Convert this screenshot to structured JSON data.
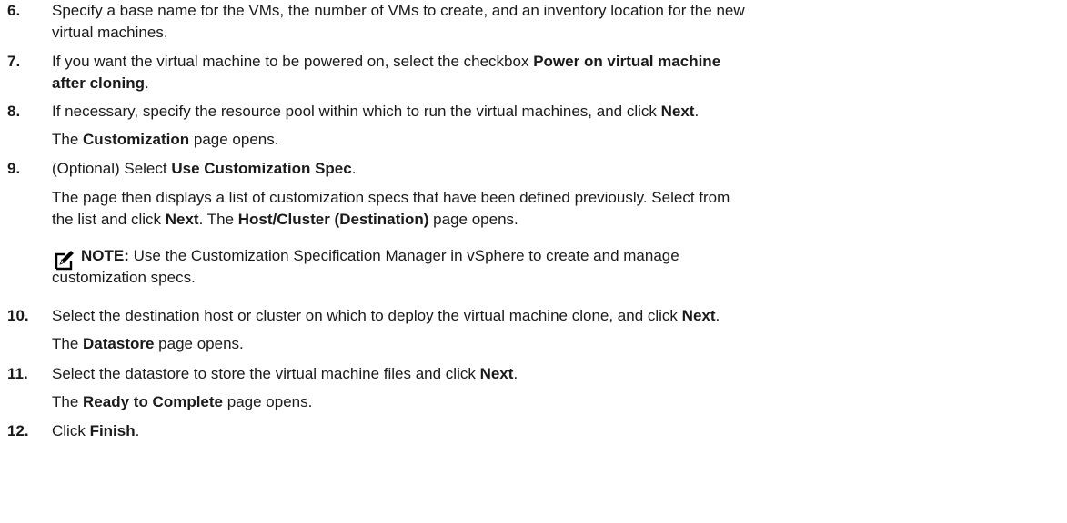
{
  "steps": {
    "s6": {
      "num": "6.",
      "line1": "Specify a base name for the VMs, the number of VMs to create, and an inventory location for the new",
      "line2": "virtual machines."
    },
    "s7": {
      "num": "7.",
      "pre": "If you want the virtual machine to be powered on, select the checkbox ",
      "bold1": "Power on virtual machine",
      "bold2": "after cloning",
      "post": "."
    },
    "s8": {
      "num": "8.",
      "pre": "If necessary, specify the resource pool within which to run the virtual machines, and click ",
      "bold": "Next",
      "post": ".",
      "result_pre": "The ",
      "result_bold": "Customization",
      "result_post": " page opens."
    },
    "s9": {
      "num": "9.",
      "pre": "(Optional) Select ",
      "bold": "Use Customization Spec",
      "post": ".",
      "desc_line1": "The page then displays a list of customization specs that have been defined previously. Select from",
      "desc2_pre": "the list and click ",
      "desc2_bold1": "Next",
      "desc2_mid": ". The ",
      "desc2_bold2": "Host/Cluster (Destination)",
      "desc2_post": " page opens.",
      "note_label": "NOTE:",
      "note_line1": " Use the Customization Specification Manager in vSphere to create and manage",
      "note_line2": "customization specs."
    },
    "s10": {
      "num": "10.",
      "pre": "Select the destination host or cluster on which to deploy the virtual machine clone, and click ",
      "bold": "Next",
      "post": ".",
      "result_pre": "The ",
      "result_bold": "Datastore",
      "result_post": " page opens."
    },
    "s11": {
      "num": "11.",
      "pre": "Select the datastore to store the virtual machine files and click ",
      "bold": "Next",
      "post": ".",
      "result_pre": "The ",
      "result_bold": "Ready to Complete",
      "result_post": " page opens."
    },
    "s12": {
      "num": "12.",
      "pre": "Click ",
      "bold": "Finish",
      "post": "."
    }
  },
  "icons": {
    "note": "pencil-note-icon"
  }
}
